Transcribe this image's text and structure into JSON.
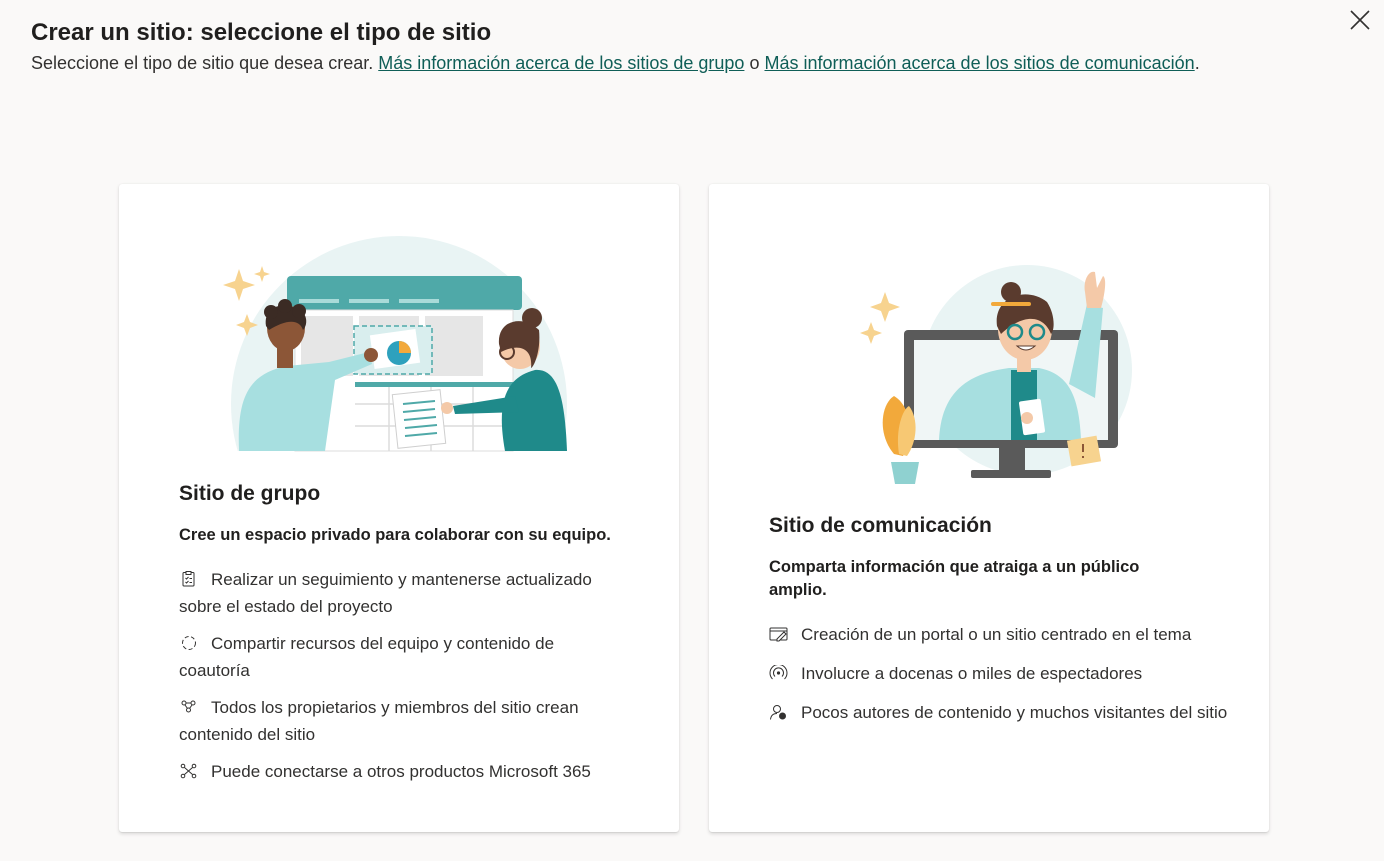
{
  "header": {
    "title": "Crear un sitio: seleccione el tipo de sitio",
    "subtitle_prefix": "Seleccione el tipo de sitio que desea crear.",
    "link_team": "Más información acerca de los sitios de grupo",
    "connector": "o",
    "link_comm": "Más información acerca de los sitios de comunicación",
    "suffix": "."
  },
  "close_icon": "close-icon",
  "team_site": {
    "title": "Sitio de grupo",
    "description": "Cree un espacio privado para colaborar con su equipo.",
    "features": [
      {
        "icon": "clipboard-icon",
        "text": "Realizar un seguimiento y mantenerse actualizado sobre el estado del proyecto"
      },
      {
        "icon": "sync-icon",
        "text": "Compartir recursos del equipo y contenido de coautoría"
      },
      {
        "icon": "people-network-icon",
        "text": "Todos los propietarios y miembros del sitio crean contenido del sitio"
      },
      {
        "icon": "connector-icon",
        "text": "Puede conectarse a otros productos Microsoft 365"
      }
    ]
  },
  "communication_site": {
    "title": "Sitio de comunicación",
    "description": "Comparta información que atraiga a un público amplio.",
    "features": [
      {
        "icon": "edit-page-icon",
        "text": "Creación de un portal o un sitio centrado en el tema"
      },
      {
        "icon": "broadcast-icon",
        "text": "Involucre a docenas o miles de espectadores"
      },
      {
        "icon": "person-feedback-icon",
        "text": "Pocos autores de contenido y muchos visitantes del sitio"
      }
    ]
  },
  "colors": {
    "teal": "#4fa9a8",
    "link": "#0f5e57",
    "background": "#faf9f8"
  }
}
